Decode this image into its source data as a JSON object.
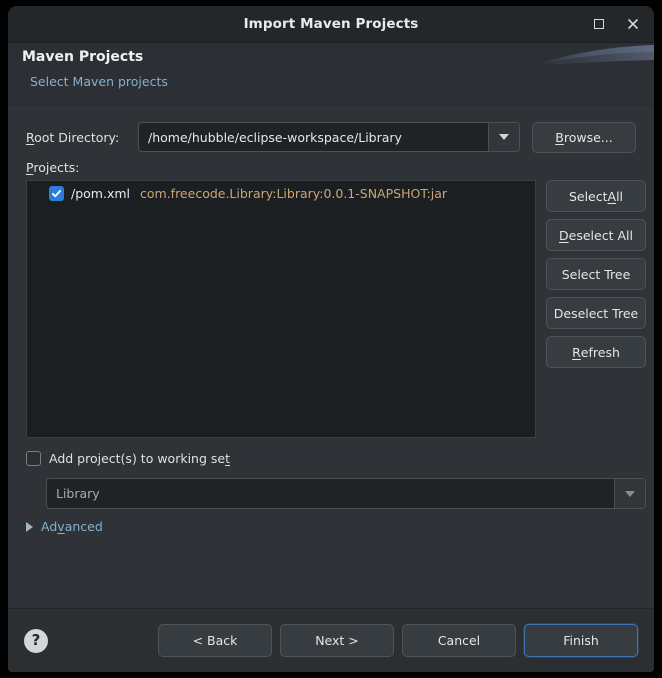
{
  "window": {
    "title": "Import Maven Projects",
    "controls": {
      "maximize_name": "maximize",
      "close_name": "close"
    }
  },
  "banner": {
    "title": "Maven Projects",
    "subtitle": "Select Maven projects"
  },
  "form": {
    "root_directory_label": "Root Directory:",
    "root_directory_mnemonic": "R",
    "root_directory_value": "/home/hubble/eclipse-workspace/Library",
    "browse_label": "Browse...",
    "browse_mnemonic": "B",
    "projects_label": "Projects:",
    "projects_mnemonic": "P"
  },
  "tree": {
    "rows": [
      {
        "checked": true,
        "file": "/pom.xml",
        "coordinates": "com.freecode.Library:Library:0.0.1-SNAPSHOT:jar"
      }
    ]
  },
  "side_buttons": [
    {
      "label_before": "Select ",
      "mnemonic": "A",
      "label_after": "ll",
      "name": "select-all-button"
    },
    {
      "label_before": "",
      "mnemonic": "D",
      "label_after": "eselect All",
      "name": "deselect-all-button"
    },
    {
      "label_before": "Select Tree",
      "mnemonic": "",
      "label_after": "",
      "name": "select-tree-button"
    },
    {
      "label_before": "Deselect Tree",
      "mnemonic": "",
      "label_after": "",
      "name": "deselect-tree-button"
    },
    {
      "label_before": "",
      "mnemonic": "R",
      "label_after": "efresh",
      "name": "refresh-button"
    }
  ],
  "working_set": {
    "checkbox_checked": false,
    "checkbox_label_before": "Add project(s) to working se",
    "checkbox_mnemonic": "t",
    "checkbox_label_after": "",
    "selected_value": "Library"
  },
  "advanced": {
    "expanded": false,
    "label_before": "Ad",
    "mnemonic": "v",
    "label_after": "anced"
  },
  "footer": {
    "help_glyph": "?",
    "buttons": [
      {
        "label": "< Back",
        "name": "back-button",
        "default": false
      },
      {
        "label": "Next >",
        "name": "next-button",
        "default": false
      },
      {
        "label": "Cancel",
        "name": "cancel-button",
        "default": false
      },
      {
        "label": "Finish",
        "name": "finish-button",
        "default": true
      }
    ]
  },
  "colors": {
    "window_bg": "#2f3337",
    "titlebar_bg": "#242729",
    "tree_bg": "#1c1f21",
    "accent_blue": "#2b7ddb",
    "link_blue": "#84b0cd",
    "coordinate_tan": "#c9a574",
    "footer_bg": "#2b2f32"
  }
}
